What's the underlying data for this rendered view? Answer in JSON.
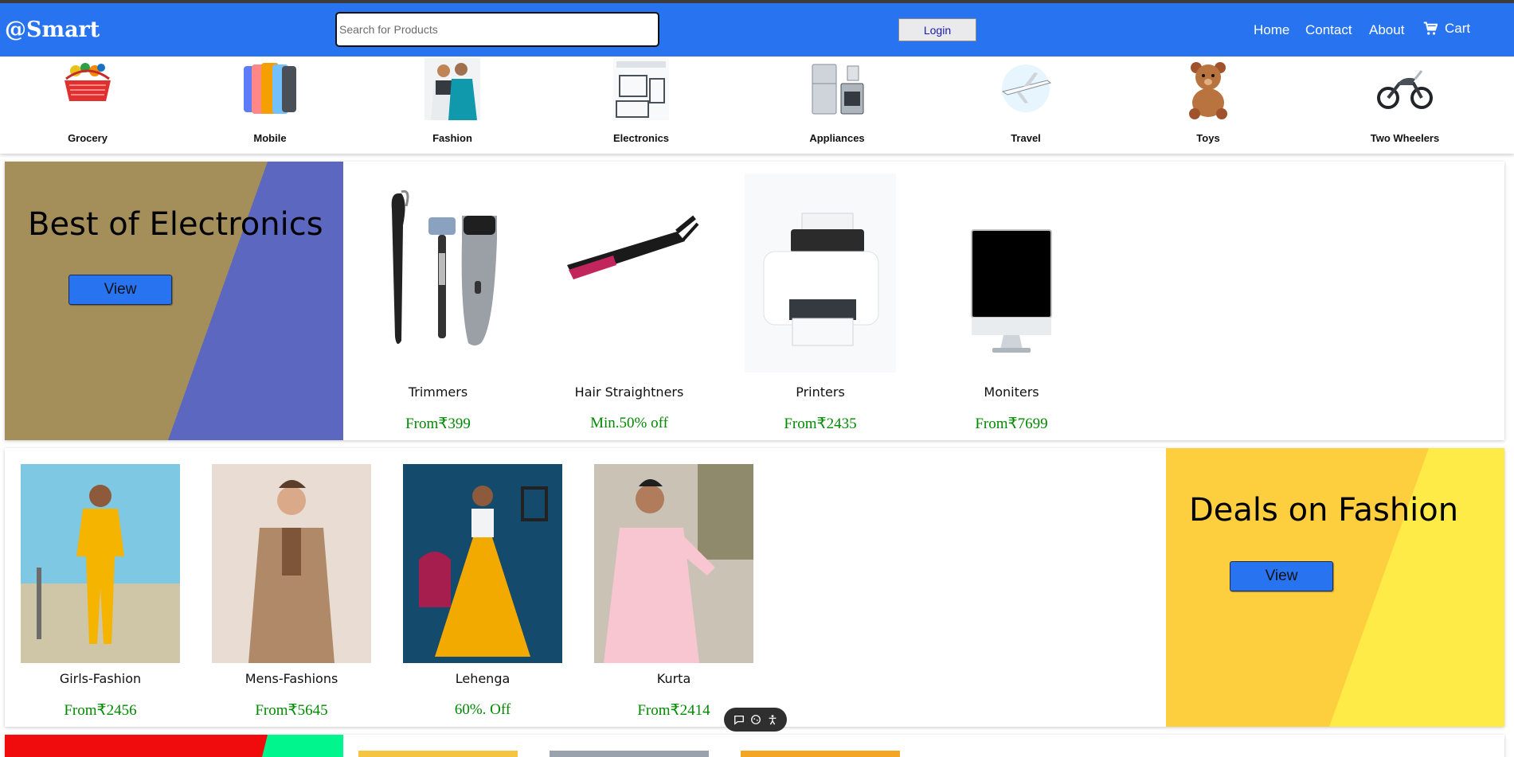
{
  "header": {
    "logo": "@Smart",
    "search_placeholder": "Search for Products",
    "login_label": "Login",
    "nav": [
      "Home",
      "Contact",
      "About"
    ],
    "cart_label": "Cart",
    "brand_color": "#2874f0"
  },
  "categories": [
    {
      "label": "Grocery",
      "icon": "grocery-basket-icon"
    },
    {
      "label": "Mobile",
      "icon": "mobile-phones-icon"
    },
    {
      "label": "Fashion",
      "icon": "fashion-couple-icon"
    },
    {
      "label": "Electronics",
      "icon": "electronics-devices-icon"
    },
    {
      "label": "Appliances",
      "icon": "appliances-icon"
    },
    {
      "label": "Travel",
      "icon": "airplane-icon"
    },
    {
      "label": "Toys",
      "icon": "teddy-bear-icon"
    },
    {
      "label": "Two Wheelers",
      "icon": "motorcycle-icon"
    }
  ],
  "electronics": {
    "title": "Best of Electronics",
    "view_label": "View",
    "products": [
      {
        "name": "Trimmers",
        "price": "From₹399"
      },
      {
        "name": "Hair Straightners",
        "price": "Min.50% off"
      },
      {
        "name": "Printers",
        "price": "From₹2435"
      },
      {
        "name": "Moniters",
        "price": "From₹7699"
      }
    ]
  },
  "fashion": {
    "title": "Deals on Fashion",
    "view_label": "View",
    "products": [
      {
        "name": "Girls-Fashion",
        "price": "From₹2456"
      },
      {
        "name": "Mens-Fashions",
        "price": "From₹5645"
      },
      {
        "name": "Lehenga",
        "price": "60%. Off"
      },
      {
        "name": "Kurta",
        "price": "From₹2414"
      }
    ]
  }
}
